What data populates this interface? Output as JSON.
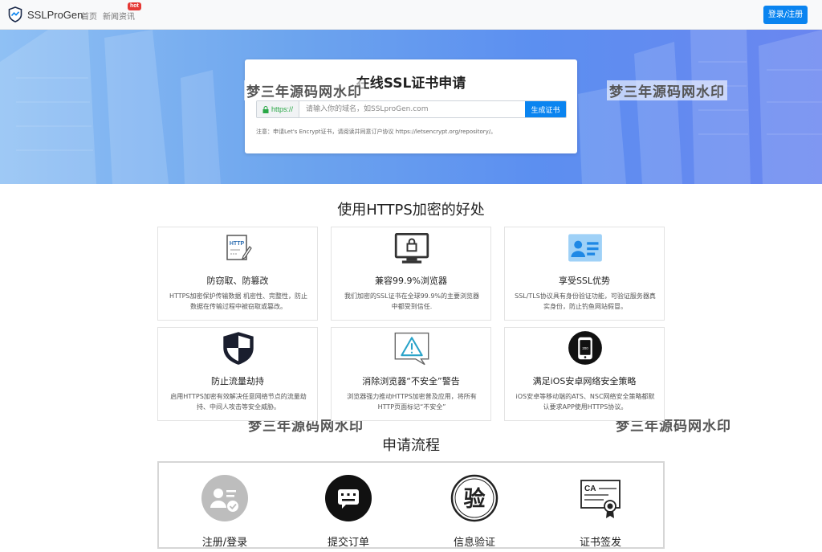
{
  "navbar": {
    "logo_text": "SSLProGen",
    "links": [
      "首页",
      "新闻资讯"
    ],
    "hot_badge": "hot",
    "login_button": "登录/注册"
  },
  "hero": {
    "title": "在线SSL证书申请",
    "prefix": "https://",
    "input_value": "",
    "input_placeholder": "请输入你的域名，如SSLproGen.com",
    "generate_button": "生成证书",
    "note": "注意：申请Let's Encrypt证书，请阅读并同意订户协议 https://letsencrypt.org/repository/。"
  },
  "watermark": "梦三年源码网水印",
  "benefits": {
    "title": "使用HTTPS加密的好处",
    "cards": [
      {
        "icon": "http-document-icon",
        "title": "防窃取、防篡改",
        "desc": "HTTPS加密保护传输数据 机密性、完整性，防止数据在传输过程中被窃取或篡改。"
      },
      {
        "icon": "browser-lock-icon",
        "title": "兼容99.9%浏览器",
        "desc": "我们加密的SSL证书在全球99.9%的主要浏览器中都受到信任."
      },
      {
        "icon": "id-card-icon",
        "title": "享受SSL优势",
        "desc": "SSL/TLS协议具有身份验证功能，可验证服务器真实身份，防止钓鱼网站假冒。"
      },
      {
        "icon": "shield-icon",
        "title": "防止流量劫持",
        "desc": "启用HTTPS加密有效解决任意网络节点的流量劫持、中间人攻击等安全威胁。"
      },
      {
        "icon": "warning-icon",
        "title": "消除浏览器“不安全”警告",
        "desc": "浏览器强力推动HTTPS加密普及应用，将所有HTTP页面标记“不安全”"
      },
      {
        "icon": "phone-icon",
        "title": "满足iOS安卓网络安全策略",
        "desc": "iOS安卓等移动端的ATS、NSC网络安全策略都默认要求APP使用HTTPS协议。"
      }
    ]
  },
  "process": {
    "title": "申请流程",
    "steps": [
      {
        "icon": "register-user-icon",
        "label": "注册/登录"
      },
      {
        "icon": "submit-order-icon",
        "label": "提交订单"
      },
      {
        "icon": "verify-icon",
        "label": "信息验证",
        "glyph": "验"
      },
      {
        "icon": "certificate-icon",
        "label": "证书签发",
        "glyph": "CA"
      }
    ]
  },
  "colors": {
    "primary": "#0a84f0",
    "hot": "#e53935",
    "https_green": "#28a745"
  }
}
